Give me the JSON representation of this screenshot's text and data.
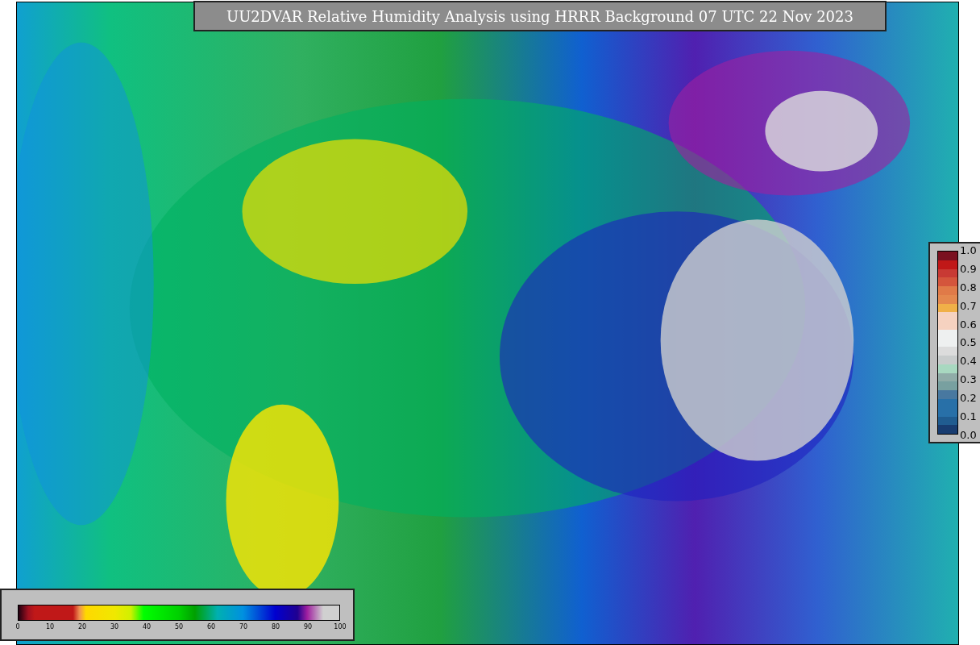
{
  "title": "UU2DVAR Relative Humidity Analysis using HRRR Background 07 UTC 22 Nov 2023",
  "humidity_colorbar": {
    "ticks": [
      "0",
      "10",
      "20",
      "30",
      "40",
      "50",
      "60",
      "70",
      "80",
      "90",
      "100"
    ]
  },
  "observation_colorbar": {
    "ticks": [
      "1.0",
      "0.9",
      "0.8",
      "0.7",
      "0.6",
      "0.5",
      "0.4",
      "0.3",
      "0.2",
      "0.1",
      "0.0"
    ]
  }
}
